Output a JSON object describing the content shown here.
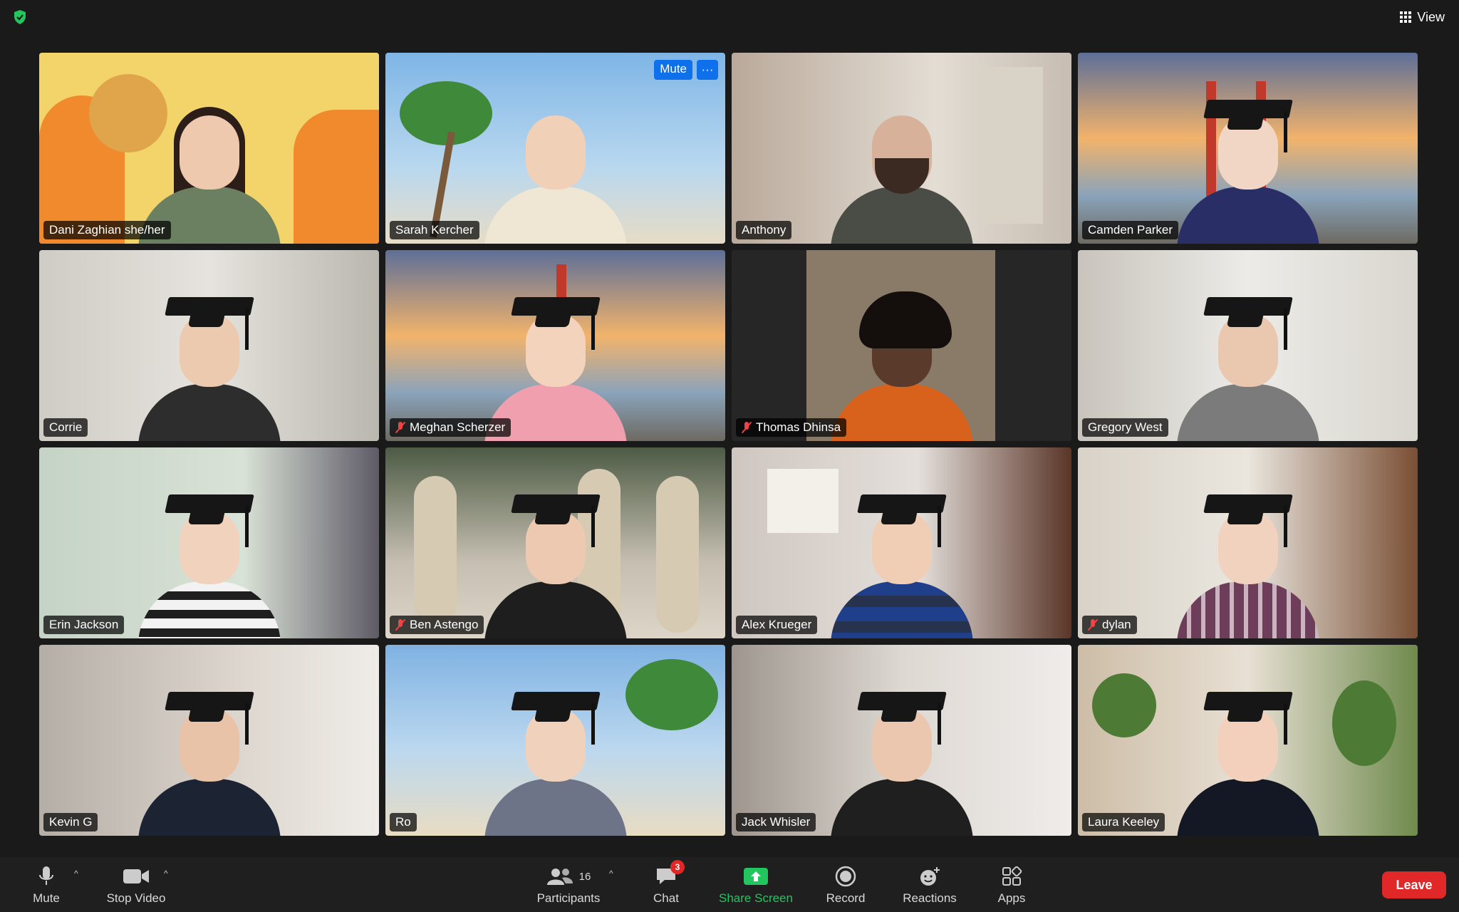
{
  "topbar": {
    "view_label": "View"
  },
  "participants": [
    {
      "name": "Dani Zaghian she/her",
      "muted": false,
      "active": true
    },
    {
      "name": "Sarah Kercher",
      "muted": false,
      "active": false
    },
    {
      "name": "Anthony",
      "muted": false,
      "active": false
    },
    {
      "name": "Camden Parker",
      "muted": false,
      "active": false
    },
    {
      "name": "Corrie",
      "muted": false,
      "active": false
    },
    {
      "name": "Meghan Scherzer",
      "muted": true,
      "active": false
    },
    {
      "name": "Thomas Dhinsa",
      "muted": true,
      "active": false
    },
    {
      "name": "Gregory West",
      "muted": false,
      "active": false
    },
    {
      "name": "Erin Jackson",
      "muted": false,
      "active": false
    },
    {
      "name": "Ben Astengo",
      "muted": true,
      "active": false
    },
    {
      "name": "Alex Krueger",
      "muted": false,
      "active": false
    },
    {
      "name": "dylan",
      "muted": true,
      "active": false
    },
    {
      "name": "Kevin G",
      "muted": false,
      "active": false
    },
    {
      "name": "Ro",
      "muted": false,
      "active": false
    },
    {
      "name": "Jack Whisler",
      "muted": false,
      "active": false
    },
    {
      "name": "Laura Keeley",
      "muted": false,
      "active": false
    }
  ],
  "hover_controls": {
    "mute_label": "Mute",
    "more_label": "···"
  },
  "toolbar": {
    "mute": "Mute",
    "stop_video": "Stop Video",
    "participants": "Participants",
    "participants_count": "16",
    "chat": "Chat",
    "chat_badge": "3",
    "share_screen": "Share Screen",
    "record": "Record",
    "reactions": "Reactions",
    "apps": "Apps",
    "leave": "Leave"
  },
  "colors": {
    "active_speaker": "#22c55e",
    "share_green": "#22c55e",
    "leave_red": "#e02828",
    "accent_blue": "#0e71eb"
  }
}
